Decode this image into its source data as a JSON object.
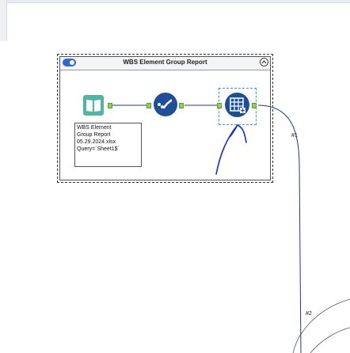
{
  "canvas": {
    "container": {
      "title": "WBS Element Group Report",
      "enabled": true
    },
    "tools": [
      {
        "name": "input-data",
        "icon": "book-input-icon"
      },
      {
        "name": "tool-2",
        "icon": "dot-check-icon"
      },
      {
        "name": "tool-3",
        "icon": "table-grid-icon"
      }
    ],
    "annotation": {
      "lines": [
        "WBS Element",
        "Group Report",
        "05.29.2024.xlsx",
        "Query=`Sheet1$`"
      ]
    },
    "wires": [
      {
        "label": "#1"
      },
      {
        "label": "#2"
      }
    ]
  },
  "colors": {
    "accent": "#2f66d8",
    "tool_blue": "#1f4f9a",
    "input_green": "#4fb6a0",
    "anchor_green": "#8fcf5a",
    "selection": "#3a9bd9",
    "ink": "#1a2fb8"
  }
}
